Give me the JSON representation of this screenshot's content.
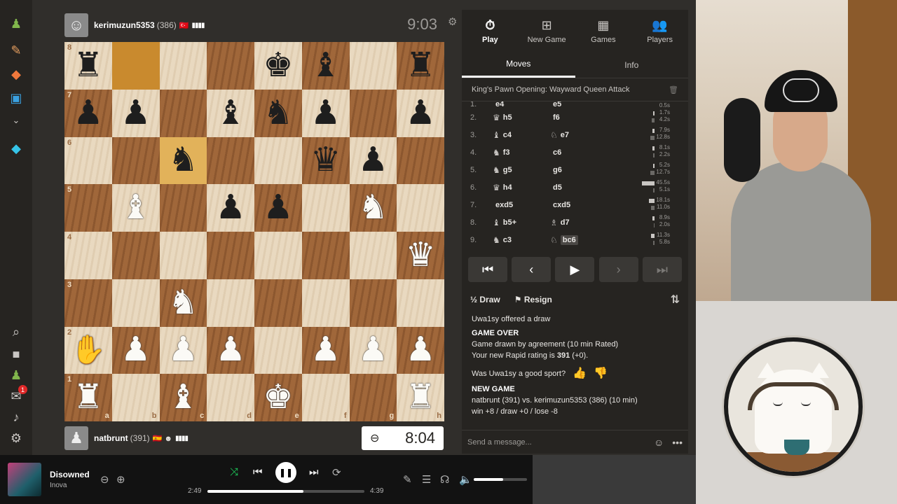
{
  "rail": {
    "icons": [
      "pawn-icon",
      "puzzle-icon",
      "learn-icon",
      "watch-icon",
      "more-chevron-icon",
      "diamond-icon",
      "search-icon",
      "profile-icon",
      "friends-icon",
      "mail-icon",
      "bell-icon",
      "settings-icon"
    ],
    "mail_badge": "1"
  },
  "top_player": {
    "name": "kerimuzun5353",
    "rating": "(386)",
    "clock": "9:03"
  },
  "bottom_player": {
    "name": "natbrunt",
    "rating": "(391)",
    "clock": "8:04"
  },
  "board": {
    "light_color": "#e9d9c0",
    "dark_color": "#a0673a",
    "highlight_squares": [
      "b8",
      "c6"
    ],
    "rank_labels": [
      "8",
      "7",
      "6",
      "5",
      "4",
      "3",
      "2",
      "1"
    ],
    "file_labels": [
      "a",
      "b",
      "c",
      "d",
      "e",
      "f",
      "g",
      "h"
    ],
    "position": [
      [
        "r",
        "",
        "",
        "",
        "k",
        "b",
        "",
        "r"
      ],
      [
        "p",
        "p",
        "",
        "b",
        "n",
        "p",
        "",
        "p"
      ],
      [
        "",
        "",
        "n",
        "",
        "",
        "q",
        "p",
        ""
      ],
      [
        "",
        "B",
        "",
        "p",
        "p",
        "",
        "N",
        ""
      ],
      [
        "",
        "",
        "",
        "",
        "",
        "",
        "",
        "Q"
      ],
      [
        "",
        "",
        "N",
        "",
        "",
        "",
        "",
        ""
      ],
      [
        "",
        "P",
        "P",
        "P",
        "",
        "P",
        "P",
        "P"
      ],
      [
        "R",
        "",
        "B",
        "",
        "K",
        "",
        "",
        "R"
      ]
    ]
  },
  "nav": [
    {
      "icon": "clock-icon",
      "label": "Play",
      "active": true
    },
    {
      "icon": "plus-square-icon",
      "label": "New Game",
      "active": false
    },
    {
      "icon": "board-icon",
      "label": "Games",
      "active": false
    },
    {
      "icon": "players-icon",
      "label": "Players",
      "active": false
    }
  ],
  "tabs": [
    {
      "label": "Moves",
      "active": true
    },
    {
      "label": "Info",
      "active": false
    }
  ],
  "opening": "King's Pawn Opening: Wayward Queen Attack",
  "moves": [
    {
      "num": "1.",
      "w": "e4",
      "wp": "",
      "b": "e5",
      "bp": "",
      "wt": "0.5s",
      "bt": "",
      "wbar": 0,
      "bbar": 0
    },
    {
      "num": "2.",
      "w": "h5",
      "wp": "♛",
      "b": "f6",
      "bp": "",
      "wt": "1.7s",
      "bt": "4.2s",
      "wbar": 2,
      "bbar": 4
    },
    {
      "num": "3.",
      "w": "c4",
      "wp": "♝",
      "b": "e7",
      "bp": "♘",
      "wt": "7.9s",
      "bt": "12.8s",
      "wbar": 3,
      "bbar": 6
    },
    {
      "num": "4.",
      "w": "f3",
      "wp": "♞",
      "b": "c6",
      "bp": "",
      "wt": "8.1s",
      "bt": "2.2s",
      "wbar": 3,
      "bbar": 2
    },
    {
      "num": "5.",
      "w": "g5",
      "wp": "♞",
      "b": "g6",
      "bp": "",
      "wt": "5.2s",
      "bt": "12.7s",
      "wbar": 2,
      "bbar": 6
    },
    {
      "num": "6.",
      "w": "h4",
      "wp": "♛",
      "b": "d5",
      "bp": "",
      "wt": "45.5s",
      "bt": "5.1s",
      "wbar": 18,
      "bbar": 2
    },
    {
      "num": "7.",
      "w": "exd5",
      "wp": "",
      "b": "cxd5",
      "bp": "",
      "wt": "18.1s",
      "bt": "11.0s",
      "wbar": 8,
      "bbar": 5
    },
    {
      "num": "8.",
      "w": "b5+",
      "wp": "♝",
      "b": "d7",
      "bp": "♗",
      "wt": "8.9s",
      "bt": "2.0s",
      "wbar": 3,
      "bbar": 1
    },
    {
      "num": "9.",
      "w": "c3",
      "wp": "♞",
      "b": "bc6",
      "bp": "♘",
      "wt": "11.3s",
      "bt": "5.8s",
      "wbar": 5,
      "bbar": 2,
      "selected": true
    }
  ],
  "controls": [
    "⏮",
    "‹",
    "▶",
    "›",
    "⏭"
  ],
  "actions": {
    "draw": "Draw",
    "draw_icon": "½",
    "resign": "Resign"
  },
  "chat": {
    "offer": "Uwa1sy offered a draw",
    "game_over": "GAME OVER",
    "result": "Game drawn by agreement (10 min Rated)",
    "rating_prefix": "Your new Rapid rating is ",
    "rating_value": "391",
    "rating_suffix": " (+0).",
    "sport_q": "Was Uwa1sy a good sport?",
    "new_game": "NEW GAME",
    "matchup": "natbrunt (391) vs. kerimuzun5353 (386) (10 min)",
    "stakes": "win +8 / draw +0 / lose -8",
    "placeholder": "Send a message..."
  },
  "spotify": {
    "title": "Disowned",
    "artist": "Inova",
    "elapsed": "2:49",
    "total": "4:39",
    "progress": 0.61,
    "volume": 0.55
  }
}
